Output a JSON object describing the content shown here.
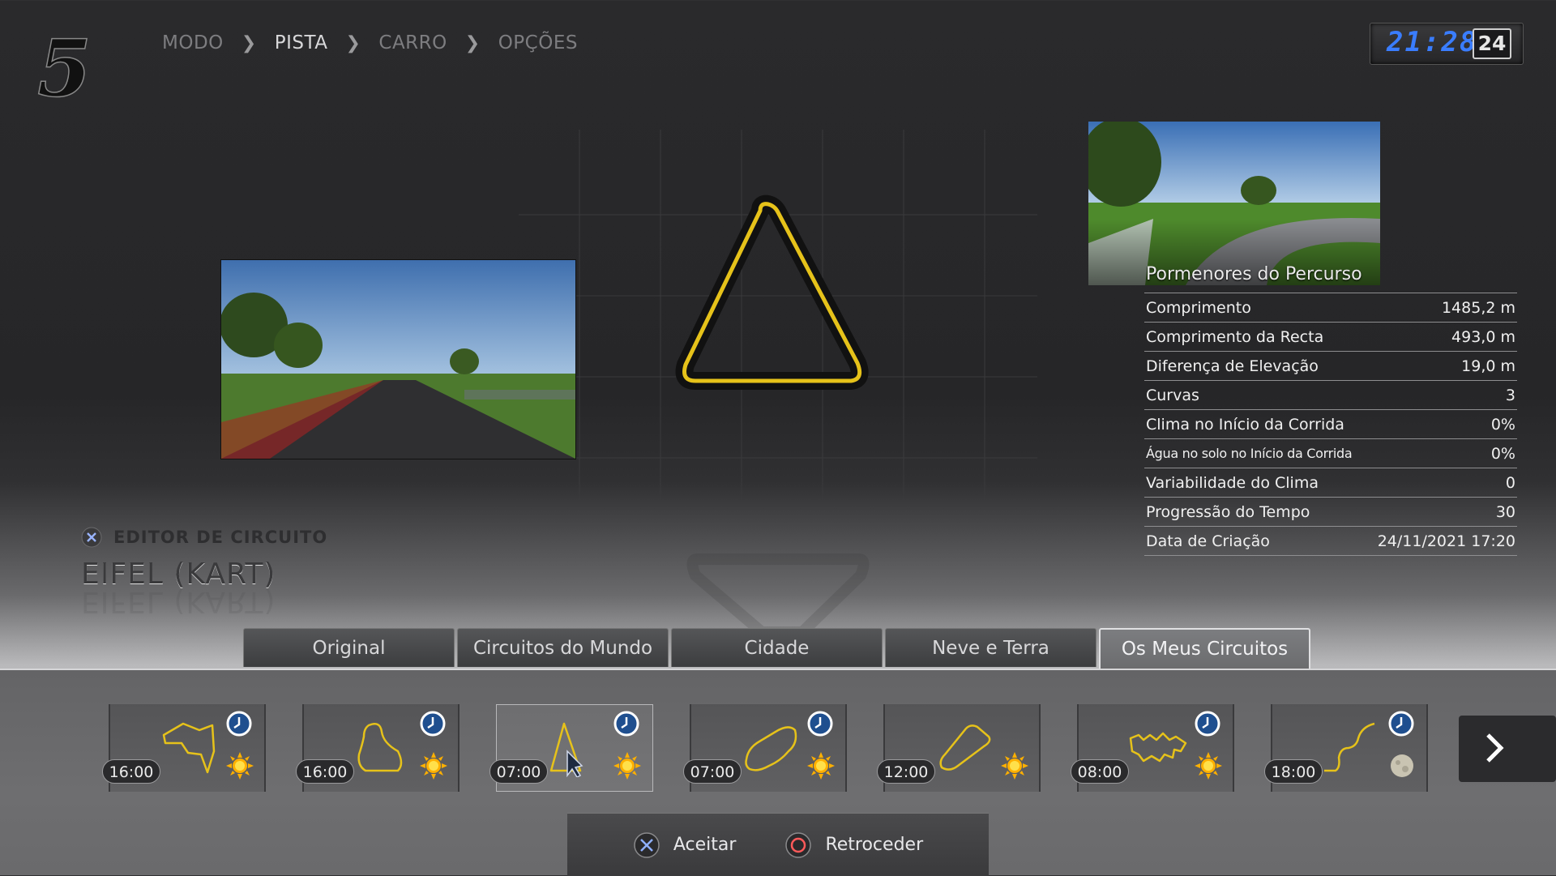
{
  "logo": {
    "text": "5"
  },
  "breadcrumb": [
    {
      "label": "MODO",
      "active": false
    },
    {
      "label": "PISTA",
      "active": true
    },
    {
      "label": "CARRO",
      "active": false
    },
    {
      "label": "OPÇÕES",
      "active": false
    }
  ],
  "clock": {
    "time": "21:28",
    "day": "24"
  },
  "details": {
    "title": "Pormenores do Percurso",
    "rows": [
      {
        "label": "Comprimento",
        "value": "1485,2 m"
      },
      {
        "label": "Comprimento da Recta",
        "value": "493,0 m"
      },
      {
        "label": "Diferença de Elevação",
        "value": "19,0 m"
      },
      {
        "label": "Curvas",
        "value": "3"
      },
      {
        "label": "Clima no Início da Corrida",
        "value": "0%"
      },
      {
        "label": "Água no solo no Início da Corrida",
        "value": "0%"
      },
      {
        "label": "Variabilidade do Clima",
        "value": "0"
      },
      {
        "label": "Progressão do Tempo",
        "value": "30"
      },
      {
        "label": "Data de Criação",
        "value": "24/11/2021 17:20"
      }
    ]
  },
  "editor": {
    "label": "EDITOR DE CIRCUITO",
    "track_name": "EIFEL (KART)"
  },
  "tabs": [
    {
      "label": "Original",
      "active": false
    },
    {
      "label": "Circuitos do Mundo",
      "active": false
    },
    {
      "label": "Cidade",
      "active": false
    },
    {
      "label": "Neve e Terra",
      "active": false
    },
    {
      "label": "Os Meus Circuitos",
      "active": true
    }
  ],
  "tracks": [
    {
      "time": "16:00",
      "weather": "sun-icon",
      "shape": "track-shape-1"
    },
    {
      "time": "16:00",
      "weather": "sun-icon",
      "shape": "track-shape-2"
    },
    {
      "time": "07:00",
      "weather": "sun-icon",
      "shape": "track-shape-triangle",
      "selected": true
    },
    {
      "time": "07:00",
      "weather": "sun-icon",
      "shape": "track-shape-4"
    },
    {
      "time": "12:00",
      "weather": "sun-icon",
      "shape": "track-shape-5"
    },
    {
      "time": "08:00",
      "weather": "sun-icon",
      "shape": "track-shape-6"
    },
    {
      "time": "18:00",
      "weather": "moon-icon",
      "shape": "track-shape-7"
    }
  ],
  "footer": {
    "accept": "Aceitar",
    "back": "Retroceder"
  },
  "colors": {
    "track_line": "#e6c21a",
    "clock_digits": "#3a7dff",
    "sun": "#ffb000"
  }
}
